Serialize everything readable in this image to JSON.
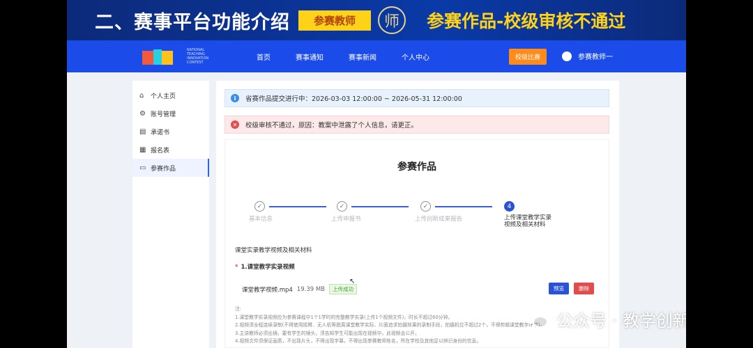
{
  "banner": {
    "title": "二、赛事平台功能介绍",
    "tag": "参赛教师",
    "seal_char": "师",
    "right_title": "参赛作品-校级审核不通过"
  },
  "nav": {
    "items": [
      "首页",
      "赛事通知",
      "赛事新闻",
      "个人中心"
    ],
    "school_button": "校级比赛",
    "user_name": "参赛教师一",
    "logo_text": "NATIONAL TEACHING INNOVATION CONTEST"
  },
  "sidebar": {
    "items": [
      {
        "label": "个人主页",
        "icon": "home-icon"
      },
      {
        "label": "账号管理",
        "icon": "gear-icon"
      },
      {
        "label": "承诺书",
        "icon": "document-icon"
      },
      {
        "label": "报名表",
        "icon": "form-icon"
      },
      {
        "label": "参赛作品",
        "icon": "folder-icon"
      }
    ],
    "active_index": 4
  },
  "alerts": {
    "info": "省赛作品提交进行中：2026-03-03 12:00:00 ~ 2026-05-31 12:00:00",
    "error": "校级审核不通过，原因：教案中泄露了个人信息，请更正。"
  },
  "card": {
    "title": "参赛作品",
    "steps": [
      {
        "label": "基本信息",
        "num": "✓"
      },
      {
        "label": "上传申报书",
        "num": "✓"
      },
      {
        "label": "上传创新成果报告",
        "num": "✓"
      },
      {
        "label": "上传课堂教学实录视频及相关材料",
        "num": "4"
      }
    ],
    "section_title": "课堂实录教学视频及相关材料",
    "subsection_title": "1.课堂教学实录视频",
    "required_mark": "*",
    "file": {
      "name": "课堂教学视频.mp4",
      "size": "19.39 MB",
      "status": "上传成功"
    },
    "preview_label": "预览",
    "delete_label": "删除",
    "notes_heading": "注:",
    "notes": [
      "1.课堂教学实录视频应为参赛课程中1个1学时的完整教学实录(上传1个视频文件)，时长不超过60分钟。",
      "2.视频须全程连续录制(不得使用摇臂、无人机等脱离课堂教学实际、片面追求拍摄效果的录制手段，拍摄机位不超过2个，不得剪辑课堂教学环节)。",
      "3.主讲教师必须出镜，要有学生的镜头，须告知学生可能出现在视频中，此视频会公开。",
      "4.视频文件须保证画质，不出现片头，不得出现字幕，不得出现参赛教师姓名，所在学校及其他足以辨识身份的信息。"
    ]
  },
  "watermark": {
    "text": "公众号 · 教学创新学"
  }
}
